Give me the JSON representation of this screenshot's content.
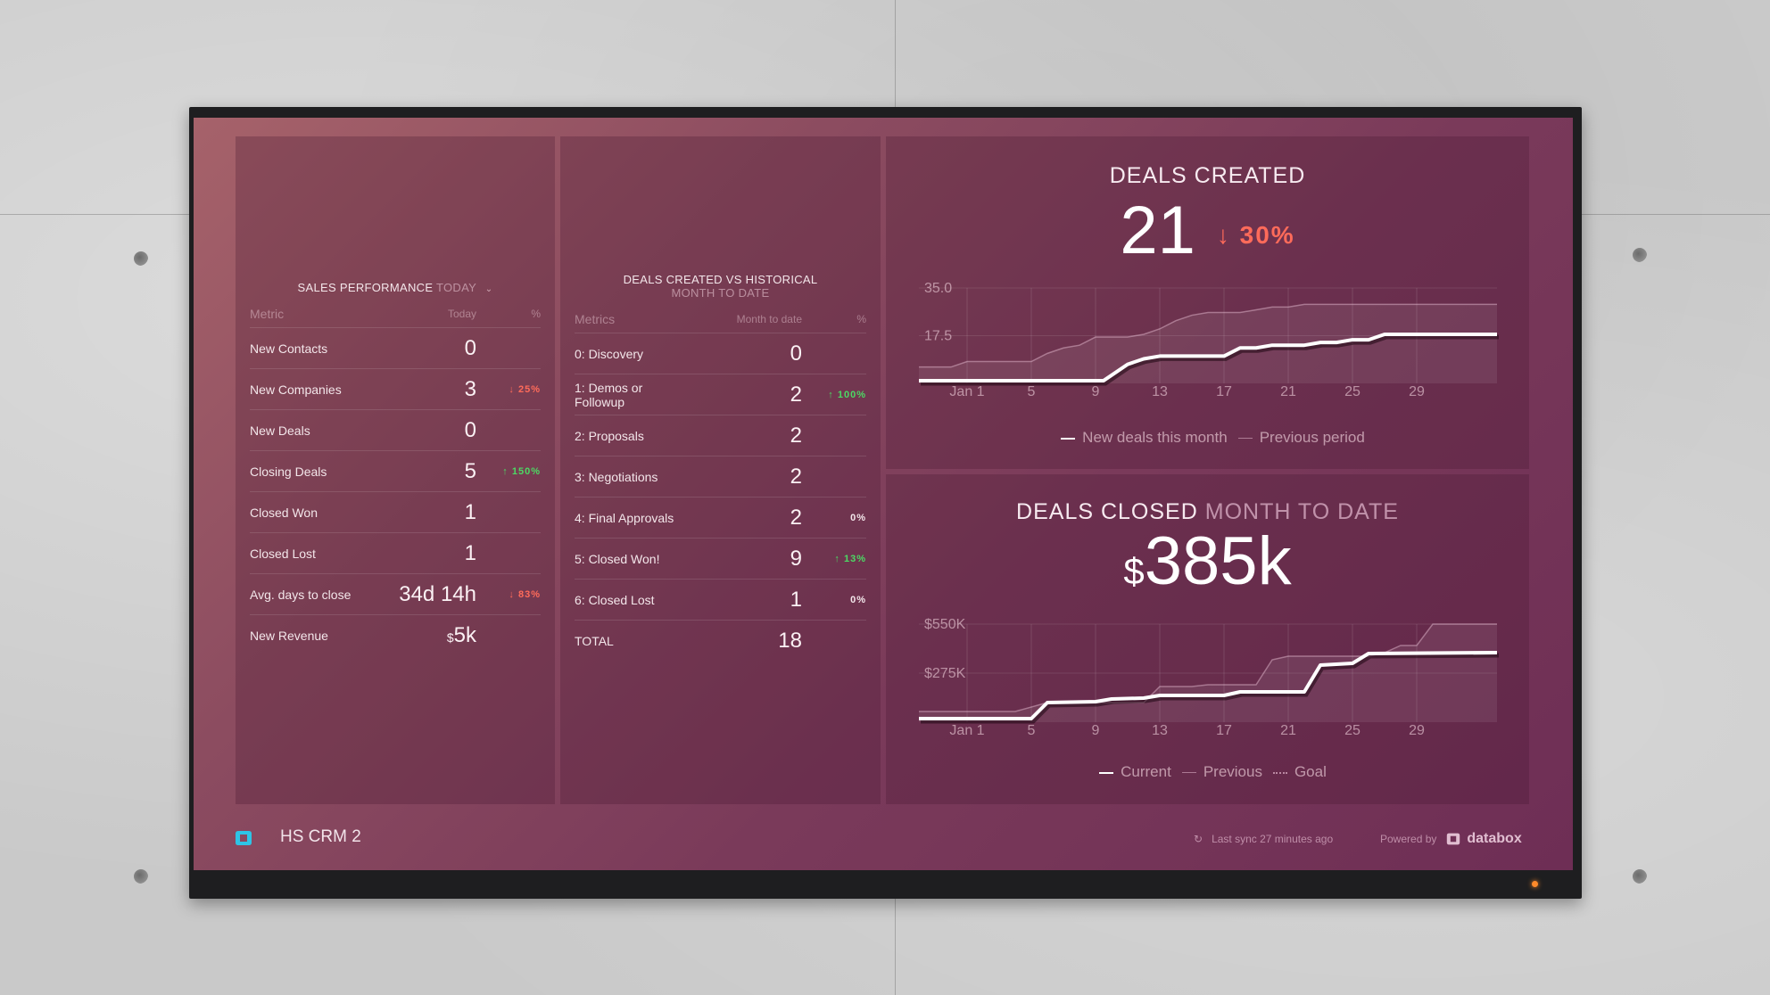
{
  "dashboard": {
    "name": "HS CRM 2",
    "last_sync": "Last sync 27 minutes ago",
    "powered_by": "Powered by",
    "brand": "databox",
    "colors": {
      "negative": "#ff6b5a",
      "positive": "#4cd964",
      "logo_accent": "#2ec4e6"
    }
  },
  "sales_performance": {
    "title": "SALES PERFORMANCE",
    "period": "TODAY",
    "columns": [
      "Metric",
      "Today",
      "%"
    ],
    "rows": [
      {
        "metric": "New Contacts",
        "value": "0",
        "pct": "",
        "trend": ""
      },
      {
        "metric": "New Companies",
        "value": "3",
        "pct": "↓ 25%",
        "trend": "down"
      },
      {
        "metric": "New Deals",
        "value": "0",
        "pct": "",
        "trend": ""
      },
      {
        "metric": "Closing Deals",
        "value": "5",
        "pct": "↑ 150%",
        "trend": "up"
      },
      {
        "metric": "Closed Won",
        "value": "1",
        "pct": "",
        "trend": ""
      },
      {
        "metric": "Closed Lost",
        "value": "1",
        "pct": "",
        "trend": ""
      },
      {
        "metric": "Avg. days to close",
        "value": "34d 14h",
        "pct": "↓ 83%",
        "trend": "down"
      },
      {
        "metric": "New Revenue",
        "currency": "$",
        "value": "5k",
        "pct": "",
        "trend": ""
      }
    ]
  },
  "deals_vs_historical": {
    "title": "DEALS CREATED VS HISTORICAL",
    "period": "MONTH TO DATE",
    "columns": [
      "Metrics",
      "Month to date",
      "%"
    ],
    "rows": [
      {
        "metric": "0: Discovery",
        "value": "0",
        "pct": "",
        "trend": ""
      },
      {
        "metric": "1: Demos or Followup",
        "value": "2",
        "pct": "↑ 100%",
        "trend": "up"
      },
      {
        "metric": "2: Proposals",
        "value": "2",
        "pct": "",
        "trend": ""
      },
      {
        "metric": "3: Negotiations",
        "value": "2",
        "pct": "",
        "trend": ""
      },
      {
        "metric": "4: Final Approvals",
        "value": "2",
        "pct": "0%",
        "trend": "neutral"
      },
      {
        "metric": "5: Closed Won!",
        "value": "9",
        "pct": "↑ 13%",
        "trend": "up"
      },
      {
        "metric": "6: Closed Lost",
        "value": "1",
        "pct": "0%",
        "trend": "neutral"
      },
      {
        "metric": "TOTAL",
        "value": "18",
        "pct": "",
        "trend": ""
      }
    ]
  },
  "deals_created": {
    "title": "DEALS CREATED",
    "value": "21",
    "delta": "↓ 30%"
  },
  "deals_closed": {
    "title": "DEALS CLOSED",
    "period": "MONTH TO DATE",
    "currency": "$",
    "value": "385k"
  },
  "chart_data": [
    {
      "type": "line",
      "title": "DEALS CREATED",
      "x_ticks": [
        "Jan 1",
        "5",
        "9",
        "13",
        "17",
        "21",
        "25",
        "29"
      ],
      "x_tick_days": [
        1,
        5,
        9,
        13,
        17,
        21,
        25,
        29
      ],
      "y_ticks": [
        "17.5",
        "35.0"
      ],
      "y_tick_values": [
        17.5,
        35.0
      ],
      "ylim": [
        0,
        35
      ],
      "xlim": [
        -2,
        34
      ],
      "grid": true,
      "legend": "bottom",
      "series": [
        {
          "name": "New deals this month",
          "style": "solid-bold",
          "x": [
            -2,
            9.5,
            11,
            12,
            13,
            17,
            18,
            19,
            20,
            22,
            23,
            24,
            25,
            26,
            27,
            34
          ],
          "y": [
            1,
            1,
            7,
            9,
            10,
            10,
            13,
            13,
            14,
            14,
            15,
            15,
            16,
            16,
            18,
            18
          ]
        },
        {
          "name": "Previous period",
          "style": "solid-thin-filled",
          "x": [
            -2,
            0,
            1,
            5,
            6,
            7,
            8,
            9,
            11,
            12,
            13,
            14,
            15,
            16,
            17,
            18,
            19,
            20,
            21,
            22,
            34
          ],
          "y": [
            6,
            6,
            8,
            8,
            11,
            13,
            14,
            17,
            17,
            18,
            20,
            23,
            25,
            26,
            26,
            26,
            27,
            28,
            28,
            29,
            29
          ]
        }
      ]
    },
    {
      "type": "line",
      "title": "DEALS CLOSED MONTH TO DATE",
      "x_ticks": [
        "Jan 1",
        "5",
        "9",
        "13",
        "17",
        "21",
        "25",
        "29"
      ],
      "x_tick_days": [
        1,
        5,
        9,
        13,
        17,
        21,
        25,
        29
      ],
      "y_ticks": [
        "$275K",
        "$550K"
      ],
      "y_tick_values": [
        275000,
        550000
      ],
      "ylim": [
        0,
        550000
      ],
      "xlim": [
        -2,
        34
      ],
      "grid": true,
      "legend": "bottom",
      "series": [
        {
          "name": "Current",
          "style": "solid-bold",
          "x": [
            -2,
            5,
            6,
            9,
            10,
            12,
            13,
            17,
            18,
            22,
            23,
            25,
            26,
            34
          ],
          "y": [
            20000,
            20000,
            110000,
            115000,
            130000,
            135000,
            150000,
            150000,
            170000,
            170000,
            320000,
            330000,
            385000,
            390000
          ]
        },
        {
          "name": "Previous",
          "style": "solid-thin-filled",
          "x": [
            -2,
            4,
            6,
            12,
            13,
            15,
            16,
            19,
            20,
            21,
            26,
            27,
            28,
            29,
            30,
            34
          ],
          "y": [
            60000,
            60000,
            110000,
            110000,
            200000,
            200000,
            210000,
            210000,
            350000,
            370000,
            370000,
            390000,
            430000,
            430000,
            550000,
            550000
          ]
        },
        {
          "name": "Goal",
          "style": "dotted",
          "x": [],
          "y": []
        }
      ]
    }
  ]
}
